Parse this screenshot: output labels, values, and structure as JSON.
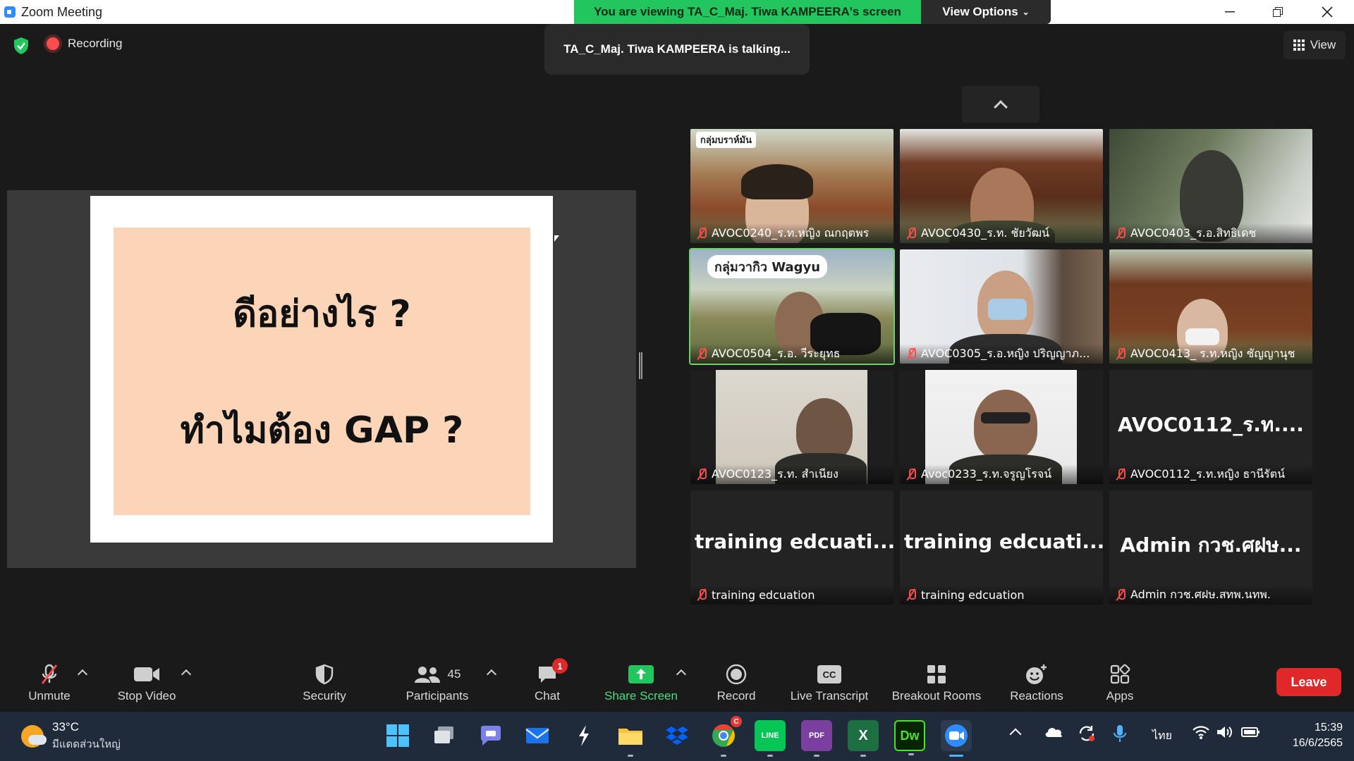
{
  "window": {
    "title": "Zoom Meeting",
    "viewing_banner": "You are viewing TA_C_Maj. Tiwa KAMPEERA's screen",
    "view_options": "View Options"
  },
  "meeting": {
    "recording_label": "Recording",
    "talking_label": "TA_C_Maj. Tiwa KAMPEERA is talking...",
    "view_label": "View"
  },
  "slide": {
    "line1": "ดีอย่างไร ?",
    "line2": "ทำไมต้อง GAP ?"
  },
  "gallery": {
    "tiles": [
      {
        "name": "AVOC0240_ร.ท.หญิง ณกฤตพร",
        "overlay": "กลุ่มบราห์มัน",
        "muted": true
      },
      {
        "name": "AVOC0430_ร.ท. ชัยวัฒน์",
        "muted": true
      },
      {
        "name": "AVOC0403_ร.อ.สิทธิเดช",
        "muted": true
      },
      {
        "name": "AVOC0504_ร.อ. วีระยุทธ",
        "overlay": "กลุ่มวากิว Wagyu",
        "muted": true
      },
      {
        "name": "AVOC0305_ร.อ.หญิง ปริญญาภ...",
        "muted": true
      },
      {
        "name": "AVOC0413_ ร.ท.หญิง ชัญญานุช",
        "muted": true
      },
      {
        "name": "AVOC0123_ร.ท. สำเนียง",
        "muted": true
      },
      {
        "name": "Avoc0233_ร.ท.จรูญโรจน์",
        "muted": true
      },
      {
        "name": "AVOC0112_ร.ท.หญิง ธานีรัตน์",
        "big": "AVOC0112_ร.ท....",
        "muted": true
      },
      {
        "name": "training edcuation",
        "big": "training edcuati...",
        "muted": true
      },
      {
        "name": "training edcuation",
        "big": "training edcuati...",
        "muted": true
      },
      {
        "name": "Admin กวช.ศฝษ.สทพ.นทพ.",
        "big": "Admin กวช.ศฝษ...",
        "muted": true
      }
    ]
  },
  "toolbar": {
    "unmute": "Unmute",
    "stop_video": "Stop Video",
    "security": "Security",
    "participants": "Participants",
    "participants_count": "45",
    "chat": "Chat",
    "chat_badge": "1",
    "share_screen": "Share Screen",
    "record": "Record",
    "live_transcript": "Live Transcript",
    "breakout_rooms": "Breakout Rooms",
    "reactions": "Reactions",
    "apps": "Apps",
    "leave": "Leave",
    "cc_icon_text": "CC"
  },
  "taskbar": {
    "temperature": "33°C",
    "weather_condition": "มีแดดส่วนใหญ่",
    "language": "ไทย",
    "time": "15:39",
    "date": "16/6/2565",
    "chrome_badge": "C",
    "dw_label": "Dw",
    "excel_label": "X",
    "line_label": "LINE",
    "pdf_label": "PDF"
  },
  "colors": {
    "accent_green": "#22c55e",
    "leave_red": "#e02828",
    "mute_red": "#ff4d4d",
    "slide_peach": "#fcd5b8"
  }
}
